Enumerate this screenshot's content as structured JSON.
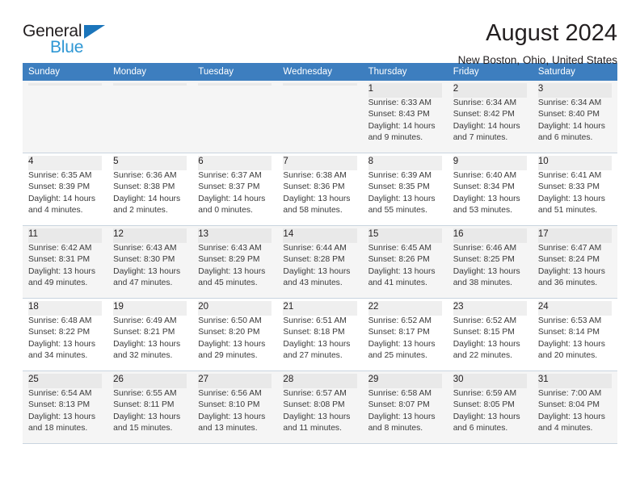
{
  "brand": {
    "name_part1": "General",
    "name_part2": "Blue",
    "triangle_color": "#1b75bb",
    "blue_text_color": "#2e97d4"
  },
  "header": {
    "title": "August 2024",
    "location": "New Boston, Ohio, United States"
  },
  "theme": {
    "header_row_bg": "#3d7ebf",
    "header_row_text": "#ffffff",
    "alt_row_bg": "#f5f5f5",
    "cell_border": "#c9d4df",
    "body_text": "#3a3a3a"
  },
  "calendar": {
    "weekday_headers": [
      "Sunday",
      "Monday",
      "Tuesday",
      "Wednesday",
      "Thursday",
      "Friday",
      "Saturday"
    ],
    "labels": {
      "sunrise_prefix": "Sunrise:",
      "sunset_prefix": "Sunset:",
      "daylight_prefix": "Daylight:"
    },
    "weeks": [
      [
        {
          "day": "",
          "line1": "",
          "line2": "",
          "line3": "",
          "line4": ""
        },
        {
          "day": "",
          "line1": "",
          "line2": "",
          "line3": "",
          "line4": ""
        },
        {
          "day": "",
          "line1": "",
          "line2": "",
          "line3": "",
          "line4": ""
        },
        {
          "day": "",
          "line1": "",
          "line2": "",
          "line3": "",
          "line4": ""
        },
        {
          "day": "1",
          "line1": "Sunrise: 6:33 AM",
          "line2": "Sunset: 8:43 PM",
          "line3": "Daylight: 14 hours",
          "line4": "and 9 minutes."
        },
        {
          "day": "2",
          "line1": "Sunrise: 6:34 AM",
          "line2": "Sunset: 8:42 PM",
          "line3": "Daylight: 14 hours",
          "line4": "and 7 minutes."
        },
        {
          "day": "3",
          "line1": "Sunrise: 6:34 AM",
          "line2": "Sunset: 8:40 PM",
          "line3": "Daylight: 14 hours",
          "line4": "and 6 minutes."
        }
      ],
      [
        {
          "day": "4",
          "line1": "Sunrise: 6:35 AM",
          "line2": "Sunset: 8:39 PM",
          "line3": "Daylight: 14 hours",
          "line4": "and 4 minutes."
        },
        {
          "day": "5",
          "line1": "Sunrise: 6:36 AM",
          "line2": "Sunset: 8:38 PM",
          "line3": "Daylight: 14 hours",
          "line4": "and 2 minutes."
        },
        {
          "day": "6",
          "line1": "Sunrise: 6:37 AM",
          "line2": "Sunset: 8:37 PM",
          "line3": "Daylight: 14 hours",
          "line4": "and 0 minutes."
        },
        {
          "day": "7",
          "line1": "Sunrise: 6:38 AM",
          "line2": "Sunset: 8:36 PM",
          "line3": "Daylight: 13 hours",
          "line4": "and 58 minutes."
        },
        {
          "day": "8",
          "line1": "Sunrise: 6:39 AM",
          "line2": "Sunset: 8:35 PM",
          "line3": "Daylight: 13 hours",
          "line4": "and 55 minutes."
        },
        {
          "day": "9",
          "line1": "Sunrise: 6:40 AM",
          "line2": "Sunset: 8:34 PM",
          "line3": "Daylight: 13 hours",
          "line4": "and 53 minutes."
        },
        {
          "day": "10",
          "line1": "Sunrise: 6:41 AM",
          "line2": "Sunset: 8:33 PM",
          "line3": "Daylight: 13 hours",
          "line4": "and 51 minutes."
        }
      ],
      [
        {
          "day": "11",
          "line1": "Sunrise: 6:42 AM",
          "line2": "Sunset: 8:31 PM",
          "line3": "Daylight: 13 hours",
          "line4": "and 49 minutes."
        },
        {
          "day": "12",
          "line1": "Sunrise: 6:43 AM",
          "line2": "Sunset: 8:30 PM",
          "line3": "Daylight: 13 hours",
          "line4": "and 47 minutes."
        },
        {
          "day": "13",
          "line1": "Sunrise: 6:43 AM",
          "line2": "Sunset: 8:29 PM",
          "line3": "Daylight: 13 hours",
          "line4": "and 45 minutes."
        },
        {
          "day": "14",
          "line1": "Sunrise: 6:44 AM",
          "line2": "Sunset: 8:28 PM",
          "line3": "Daylight: 13 hours",
          "line4": "and 43 minutes."
        },
        {
          "day": "15",
          "line1": "Sunrise: 6:45 AM",
          "line2": "Sunset: 8:26 PM",
          "line3": "Daylight: 13 hours",
          "line4": "and 41 minutes."
        },
        {
          "day": "16",
          "line1": "Sunrise: 6:46 AM",
          "line2": "Sunset: 8:25 PM",
          "line3": "Daylight: 13 hours",
          "line4": "and 38 minutes."
        },
        {
          "day": "17",
          "line1": "Sunrise: 6:47 AM",
          "line2": "Sunset: 8:24 PM",
          "line3": "Daylight: 13 hours",
          "line4": "and 36 minutes."
        }
      ],
      [
        {
          "day": "18",
          "line1": "Sunrise: 6:48 AM",
          "line2": "Sunset: 8:22 PM",
          "line3": "Daylight: 13 hours",
          "line4": "and 34 minutes."
        },
        {
          "day": "19",
          "line1": "Sunrise: 6:49 AM",
          "line2": "Sunset: 8:21 PM",
          "line3": "Daylight: 13 hours",
          "line4": "and 32 minutes."
        },
        {
          "day": "20",
          "line1": "Sunrise: 6:50 AM",
          "line2": "Sunset: 8:20 PM",
          "line3": "Daylight: 13 hours",
          "line4": "and 29 minutes."
        },
        {
          "day": "21",
          "line1": "Sunrise: 6:51 AM",
          "line2": "Sunset: 8:18 PM",
          "line3": "Daylight: 13 hours",
          "line4": "and 27 minutes."
        },
        {
          "day": "22",
          "line1": "Sunrise: 6:52 AM",
          "line2": "Sunset: 8:17 PM",
          "line3": "Daylight: 13 hours",
          "line4": "and 25 minutes."
        },
        {
          "day": "23",
          "line1": "Sunrise: 6:52 AM",
          "line2": "Sunset: 8:15 PM",
          "line3": "Daylight: 13 hours",
          "line4": "and 22 minutes."
        },
        {
          "day": "24",
          "line1": "Sunrise: 6:53 AM",
          "line2": "Sunset: 8:14 PM",
          "line3": "Daylight: 13 hours",
          "line4": "and 20 minutes."
        }
      ],
      [
        {
          "day": "25",
          "line1": "Sunrise: 6:54 AM",
          "line2": "Sunset: 8:13 PM",
          "line3": "Daylight: 13 hours",
          "line4": "and 18 minutes."
        },
        {
          "day": "26",
          "line1": "Sunrise: 6:55 AM",
          "line2": "Sunset: 8:11 PM",
          "line3": "Daylight: 13 hours",
          "line4": "and 15 minutes."
        },
        {
          "day": "27",
          "line1": "Sunrise: 6:56 AM",
          "line2": "Sunset: 8:10 PM",
          "line3": "Daylight: 13 hours",
          "line4": "and 13 minutes."
        },
        {
          "day": "28",
          "line1": "Sunrise: 6:57 AM",
          "line2": "Sunset: 8:08 PM",
          "line3": "Daylight: 13 hours",
          "line4": "and 11 minutes."
        },
        {
          "day": "29",
          "line1": "Sunrise: 6:58 AM",
          "line2": "Sunset: 8:07 PM",
          "line3": "Daylight: 13 hours",
          "line4": "and 8 minutes."
        },
        {
          "day": "30",
          "line1": "Sunrise: 6:59 AM",
          "line2": "Sunset: 8:05 PM",
          "line3": "Daylight: 13 hours",
          "line4": "and 6 minutes."
        },
        {
          "day": "31",
          "line1": "Sunrise: 7:00 AM",
          "line2": "Sunset: 8:04 PM",
          "line3": "Daylight: 13 hours",
          "line4": "and 4 minutes."
        }
      ]
    ]
  }
}
